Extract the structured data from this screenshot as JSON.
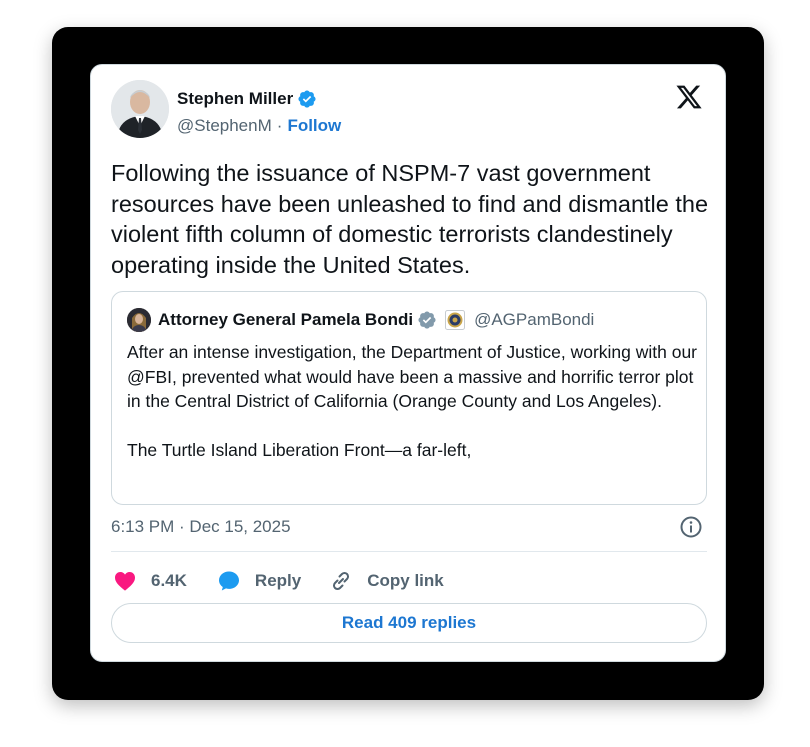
{
  "author": {
    "name": "Stephen Miller",
    "handle": "@StephenM",
    "separator": "·",
    "follow_label": "Follow"
  },
  "tweet": {
    "text": "Following the issuance of NSPM-7 vast government resources have been unleashed to find and dismantle the violent fifth column of domestic terrorists clandestinely operating inside the United States."
  },
  "quoted": {
    "name": "Attorney General Pamela Bondi",
    "handle": "@AGPamBondi",
    "paragraph1": "After an intense investigation, the Department of Justice, working with our @FBI, prevented what would have been a massive and horrific terror plot in the Central District of California (Orange County and Los Angeles).",
    "paragraph2": "The Turtle Island Liberation Front—a far-left,"
  },
  "meta": {
    "timestamp": "6:13 PM · Dec 15, 2025"
  },
  "actions": {
    "like_count": "6.4K",
    "reply_label": "Reply",
    "copy_link_label": "Copy link"
  },
  "replies_button": {
    "label": "Read 409 replies"
  },
  "icons": {
    "logo": "x-logo-icon",
    "verified": "verified-badge-icon",
    "like": "heart-icon",
    "reply": "speech-bubble-icon",
    "copy": "link-icon",
    "info": "info-icon"
  },
  "colors": {
    "accent": "#1d77d1",
    "verified_blue": "#1d9bf0",
    "verified_gray": "#829aab",
    "like_pink": "#f91880",
    "text_primary": "#0f1419",
    "text_secondary": "#536471",
    "border": "#cfd9de"
  }
}
